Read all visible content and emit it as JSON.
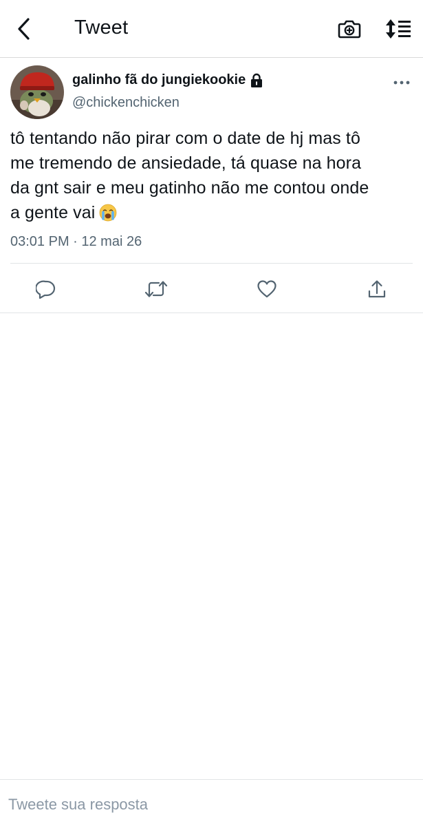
{
  "header": {
    "title": "Tweet",
    "back_icon": "chevron-left-icon",
    "camera_icon": "camera-plus-icon",
    "sort_icon": "sort-list-icon"
  },
  "tweet": {
    "author_name": "galinho fã do jungiekookie",
    "protected_icon": "lock-icon",
    "handle": "@chickenchicken",
    "text_lines": [
      "tô tentando não pirar com o date de hj mas tô",
      "me tremendo de ansiedade, tá quase na hora",
      "da gnt sair e meu gatinho não me contou onde",
      "a gente vai"
    ],
    "emoji": "😭",
    "meta": "03:01 PM · 12 mai 26"
  },
  "actions": [
    {
      "name": "reply",
      "icon": "reply-icon"
    },
    {
      "name": "retweet",
      "icon": "retweet-icon"
    },
    {
      "name": "like",
      "icon": "heart-icon"
    },
    {
      "name": "share",
      "icon": "share-icon"
    }
  ],
  "reply": {
    "placeholder": "Tweete sua resposta"
  },
  "colors": {
    "text": "#0f1419",
    "secondary": "#536471",
    "divider": "#e1e4e6",
    "avatar_bg": "#6b5a4e",
    "helmet": "#c0271e"
  }
}
